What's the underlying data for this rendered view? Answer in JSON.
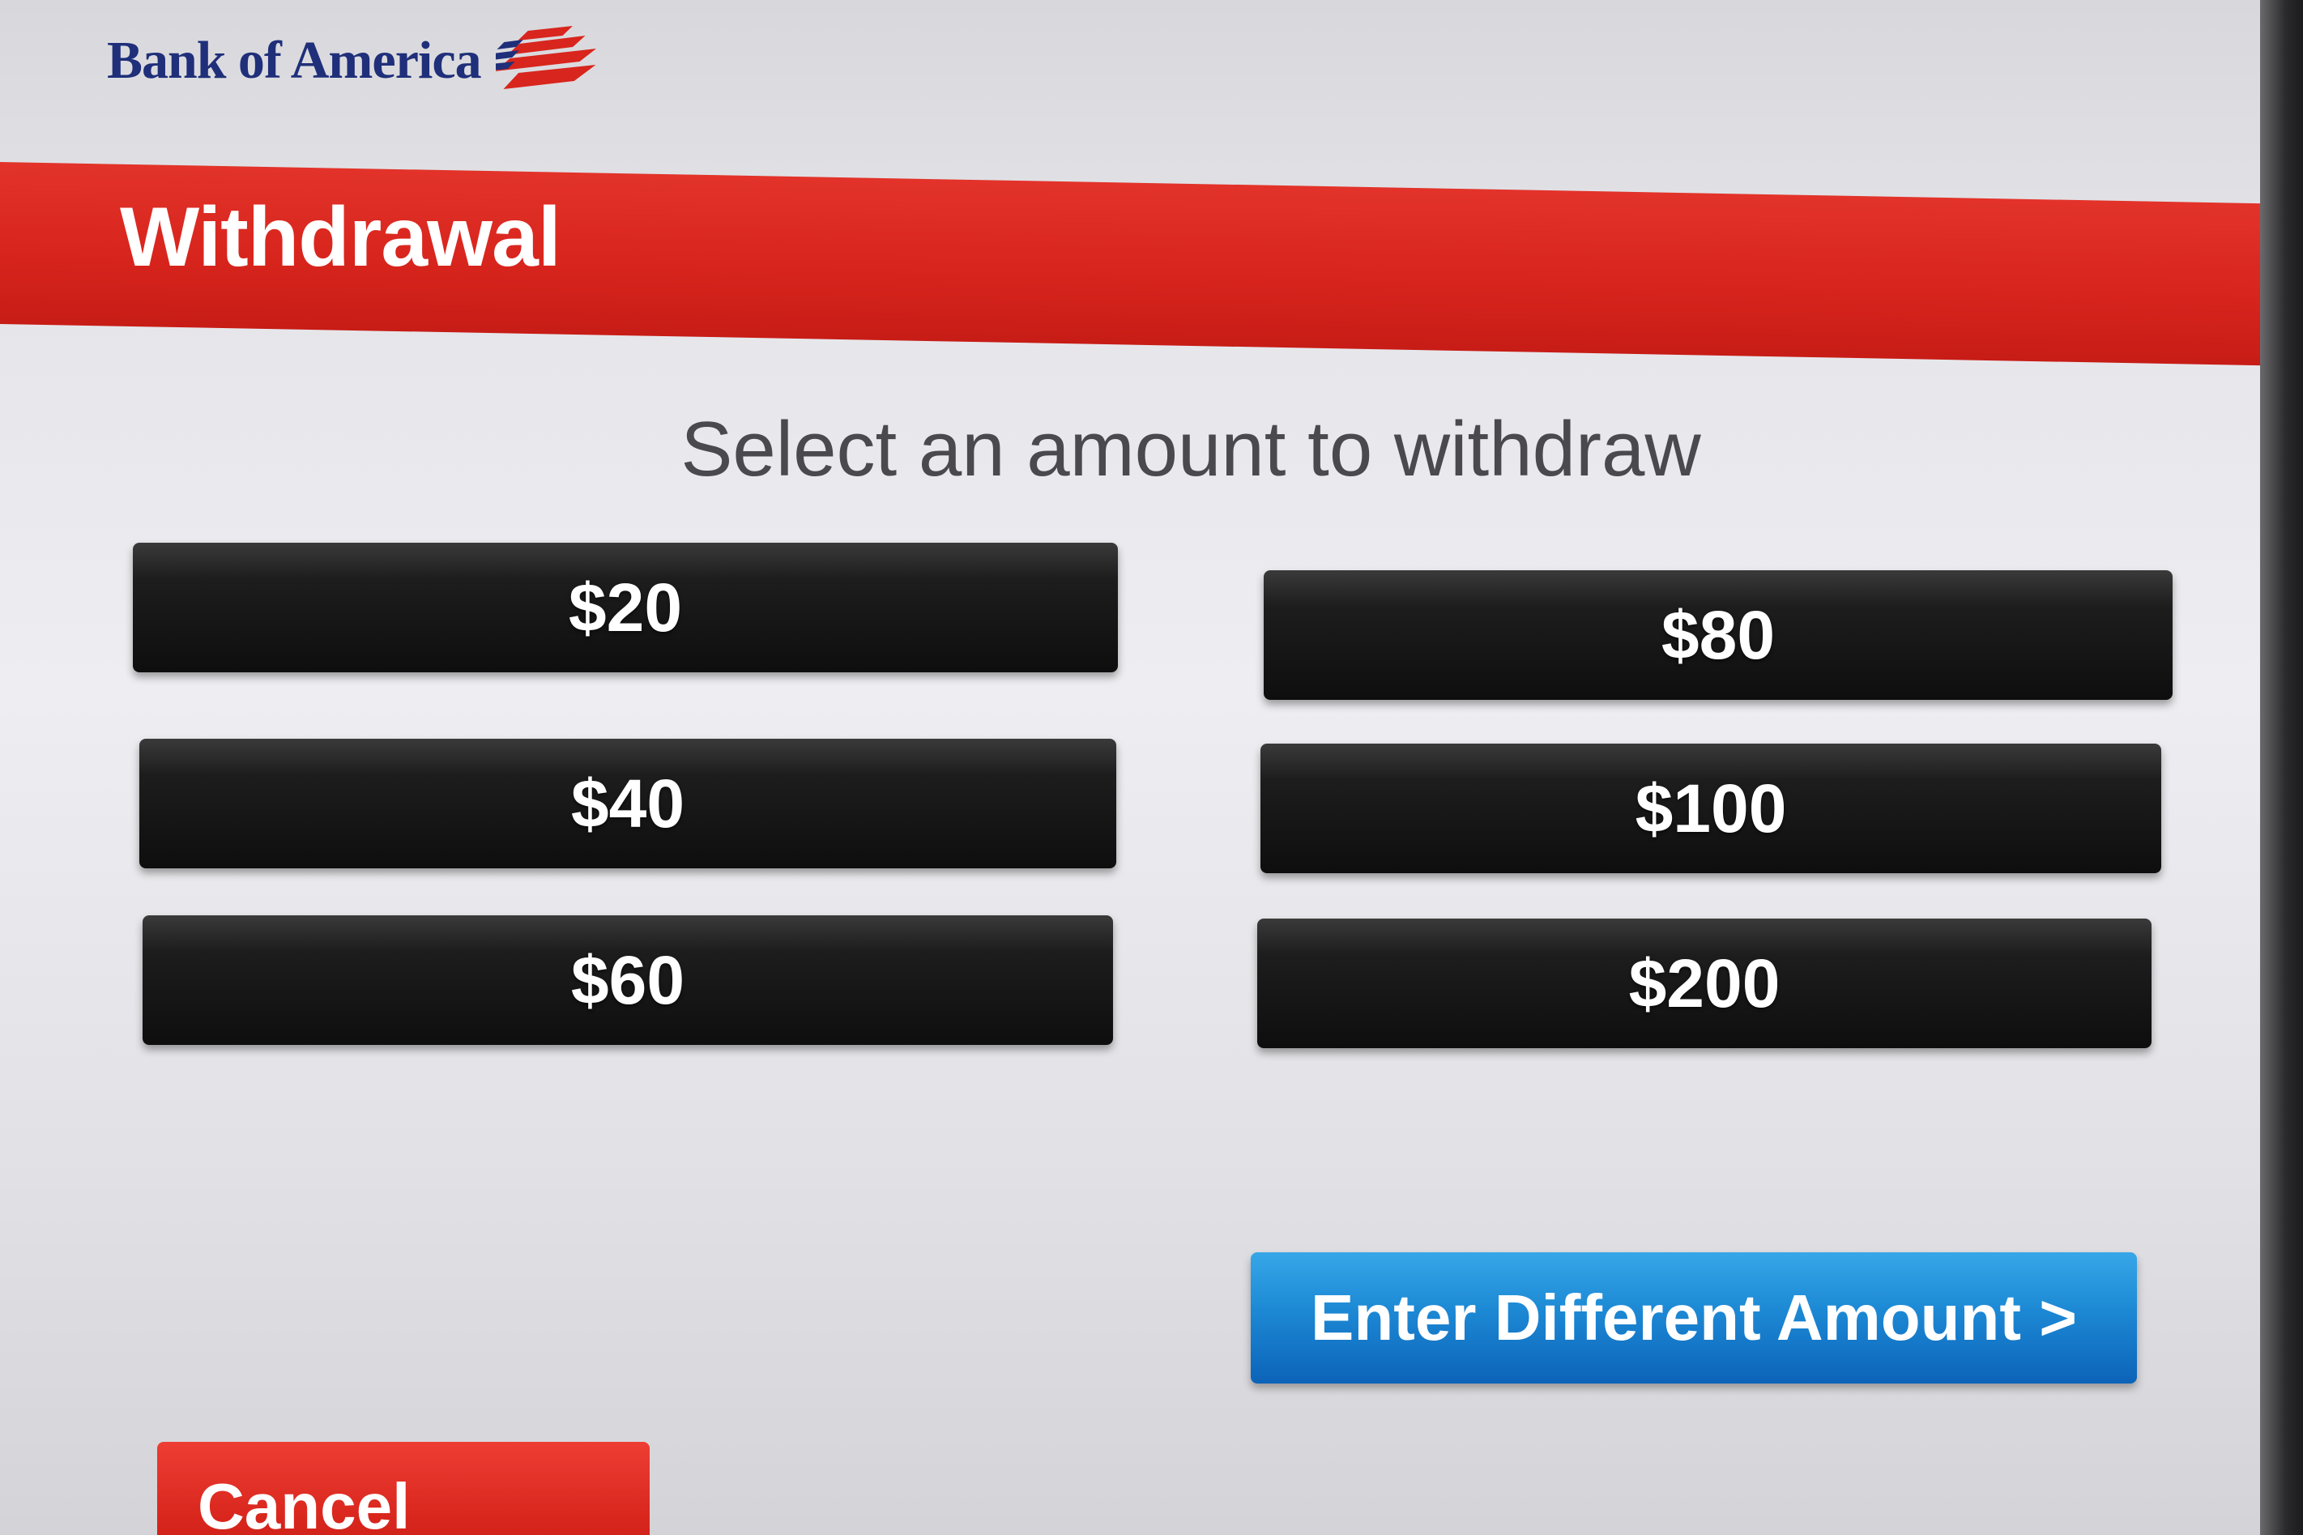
{
  "brand": {
    "name": "Bank of America",
    "logo_icon": "flag-logo-icon"
  },
  "header": {
    "title": "Withdrawal"
  },
  "main": {
    "prompt": "Select an amount to withdraw",
    "amounts": [
      "$20",
      "$40",
      "$60",
      "$80",
      "$100",
      "$200"
    ],
    "enter_different": "Enter Different Amount >",
    "cancel": "Cancel"
  },
  "colors": {
    "brand_red": "#d8251d",
    "brand_navy": "#1f2f7a",
    "button_black": "#111111",
    "button_blue": "#1c88d4"
  }
}
